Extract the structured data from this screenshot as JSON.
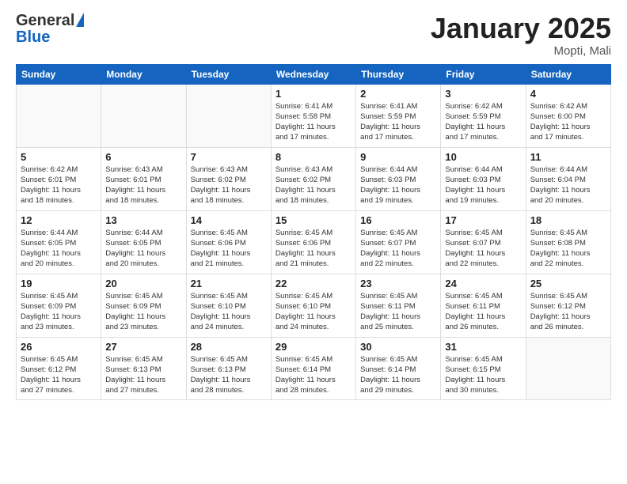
{
  "header": {
    "logo_general": "General",
    "logo_blue": "Blue",
    "month_title": "January 2025",
    "location": "Mopti, Mali"
  },
  "days_of_week": [
    "Sunday",
    "Monday",
    "Tuesday",
    "Wednesday",
    "Thursday",
    "Friday",
    "Saturday"
  ],
  "weeks": [
    [
      {
        "day": "",
        "info": ""
      },
      {
        "day": "",
        "info": ""
      },
      {
        "day": "",
        "info": ""
      },
      {
        "day": "1",
        "info": "Sunrise: 6:41 AM\nSunset: 5:58 PM\nDaylight: 11 hours\nand 17 minutes."
      },
      {
        "day": "2",
        "info": "Sunrise: 6:41 AM\nSunset: 5:59 PM\nDaylight: 11 hours\nand 17 minutes."
      },
      {
        "day": "3",
        "info": "Sunrise: 6:42 AM\nSunset: 5:59 PM\nDaylight: 11 hours\nand 17 minutes."
      },
      {
        "day": "4",
        "info": "Sunrise: 6:42 AM\nSunset: 6:00 PM\nDaylight: 11 hours\nand 17 minutes."
      }
    ],
    [
      {
        "day": "5",
        "info": "Sunrise: 6:42 AM\nSunset: 6:01 PM\nDaylight: 11 hours\nand 18 minutes."
      },
      {
        "day": "6",
        "info": "Sunrise: 6:43 AM\nSunset: 6:01 PM\nDaylight: 11 hours\nand 18 minutes."
      },
      {
        "day": "7",
        "info": "Sunrise: 6:43 AM\nSunset: 6:02 PM\nDaylight: 11 hours\nand 18 minutes."
      },
      {
        "day": "8",
        "info": "Sunrise: 6:43 AM\nSunset: 6:02 PM\nDaylight: 11 hours\nand 18 minutes."
      },
      {
        "day": "9",
        "info": "Sunrise: 6:44 AM\nSunset: 6:03 PM\nDaylight: 11 hours\nand 19 minutes."
      },
      {
        "day": "10",
        "info": "Sunrise: 6:44 AM\nSunset: 6:03 PM\nDaylight: 11 hours\nand 19 minutes."
      },
      {
        "day": "11",
        "info": "Sunrise: 6:44 AM\nSunset: 6:04 PM\nDaylight: 11 hours\nand 20 minutes."
      }
    ],
    [
      {
        "day": "12",
        "info": "Sunrise: 6:44 AM\nSunset: 6:05 PM\nDaylight: 11 hours\nand 20 minutes."
      },
      {
        "day": "13",
        "info": "Sunrise: 6:44 AM\nSunset: 6:05 PM\nDaylight: 11 hours\nand 20 minutes."
      },
      {
        "day": "14",
        "info": "Sunrise: 6:45 AM\nSunset: 6:06 PM\nDaylight: 11 hours\nand 21 minutes."
      },
      {
        "day": "15",
        "info": "Sunrise: 6:45 AM\nSunset: 6:06 PM\nDaylight: 11 hours\nand 21 minutes."
      },
      {
        "day": "16",
        "info": "Sunrise: 6:45 AM\nSunset: 6:07 PM\nDaylight: 11 hours\nand 22 minutes."
      },
      {
        "day": "17",
        "info": "Sunrise: 6:45 AM\nSunset: 6:07 PM\nDaylight: 11 hours\nand 22 minutes."
      },
      {
        "day": "18",
        "info": "Sunrise: 6:45 AM\nSunset: 6:08 PM\nDaylight: 11 hours\nand 22 minutes."
      }
    ],
    [
      {
        "day": "19",
        "info": "Sunrise: 6:45 AM\nSunset: 6:09 PM\nDaylight: 11 hours\nand 23 minutes."
      },
      {
        "day": "20",
        "info": "Sunrise: 6:45 AM\nSunset: 6:09 PM\nDaylight: 11 hours\nand 23 minutes."
      },
      {
        "day": "21",
        "info": "Sunrise: 6:45 AM\nSunset: 6:10 PM\nDaylight: 11 hours\nand 24 minutes."
      },
      {
        "day": "22",
        "info": "Sunrise: 6:45 AM\nSunset: 6:10 PM\nDaylight: 11 hours\nand 24 minutes."
      },
      {
        "day": "23",
        "info": "Sunrise: 6:45 AM\nSunset: 6:11 PM\nDaylight: 11 hours\nand 25 minutes."
      },
      {
        "day": "24",
        "info": "Sunrise: 6:45 AM\nSunset: 6:11 PM\nDaylight: 11 hours\nand 26 minutes."
      },
      {
        "day": "25",
        "info": "Sunrise: 6:45 AM\nSunset: 6:12 PM\nDaylight: 11 hours\nand 26 minutes."
      }
    ],
    [
      {
        "day": "26",
        "info": "Sunrise: 6:45 AM\nSunset: 6:12 PM\nDaylight: 11 hours\nand 27 minutes."
      },
      {
        "day": "27",
        "info": "Sunrise: 6:45 AM\nSunset: 6:13 PM\nDaylight: 11 hours\nand 27 minutes."
      },
      {
        "day": "28",
        "info": "Sunrise: 6:45 AM\nSunset: 6:13 PM\nDaylight: 11 hours\nand 28 minutes."
      },
      {
        "day": "29",
        "info": "Sunrise: 6:45 AM\nSunset: 6:14 PM\nDaylight: 11 hours\nand 28 minutes."
      },
      {
        "day": "30",
        "info": "Sunrise: 6:45 AM\nSunset: 6:14 PM\nDaylight: 11 hours\nand 29 minutes."
      },
      {
        "day": "31",
        "info": "Sunrise: 6:45 AM\nSunset: 6:15 PM\nDaylight: 11 hours\nand 30 minutes."
      },
      {
        "day": "",
        "info": ""
      }
    ]
  ]
}
